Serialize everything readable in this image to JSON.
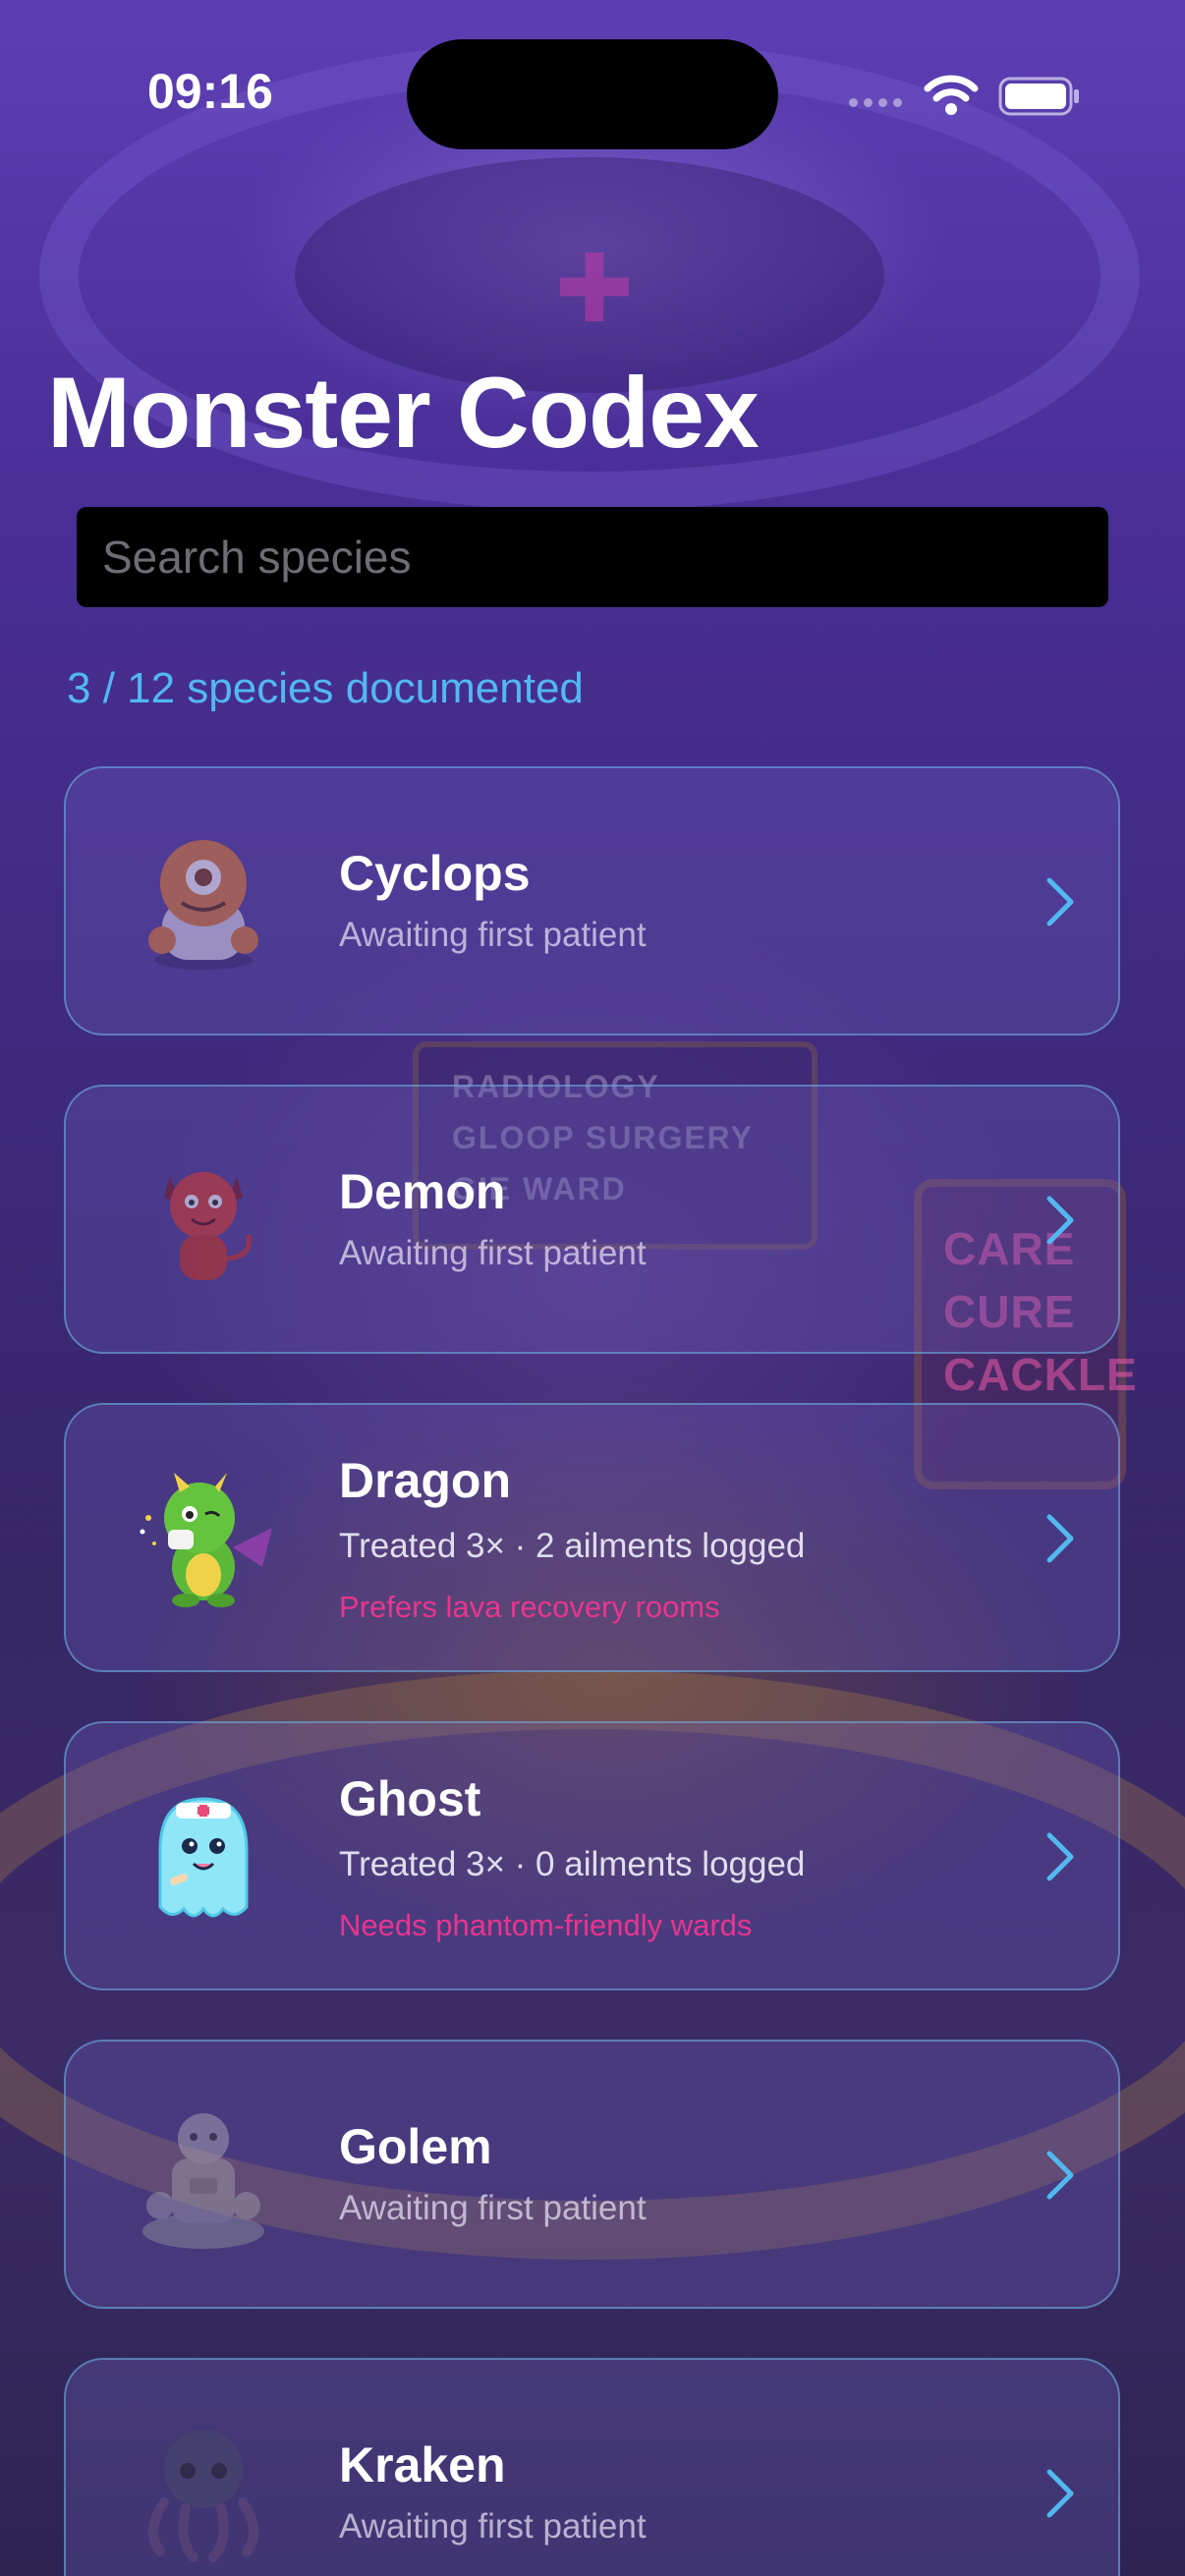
{
  "status_bar": {
    "time": "09:16"
  },
  "title": "Monster Codex",
  "search": {
    "placeholder": "Search species",
    "value": ""
  },
  "count_text": "3 / 12 species documented",
  "background_signs": {
    "ward_sign": [
      "RADIOLOGY",
      "GLOOP SURGERY",
      "GIE WARD"
    ],
    "care_sign": [
      "CARE",
      "CURE",
      "CACKLE"
    ]
  },
  "species": [
    {
      "name": "Cyclops",
      "subtitle": "Awaiting first patient",
      "note": "",
      "icon": "cyclops-icon",
      "documented": false
    },
    {
      "name": "Demon",
      "subtitle": "Awaiting first patient",
      "note": "",
      "icon": "demon-icon",
      "documented": false
    },
    {
      "name": "Dragon",
      "subtitle": "Treated 3× · 2 ailments logged",
      "note": "Prefers lava recovery rooms",
      "icon": "dragon-icon",
      "documented": true
    },
    {
      "name": "Ghost",
      "subtitle": "Treated 3× · 0 ailments logged",
      "note": "Needs phantom-friendly wards",
      "icon": "ghost-icon",
      "documented": true
    },
    {
      "name": "Golem",
      "subtitle": "Awaiting first patient",
      "note": "",
      "icon": "golem-icon",
      "documented": false
    },
    {
      "name": "Kraken",
      "subtitle": "Awaiting first patient",
      "note": "",
      "icon": "kraken-icon",
      "documented": false
    }
  ],
  "colors": {
    "accent": "#52b8f0",
    "note": "#e8358e",
    "card_border": "#6eb4e6"
  }
}
